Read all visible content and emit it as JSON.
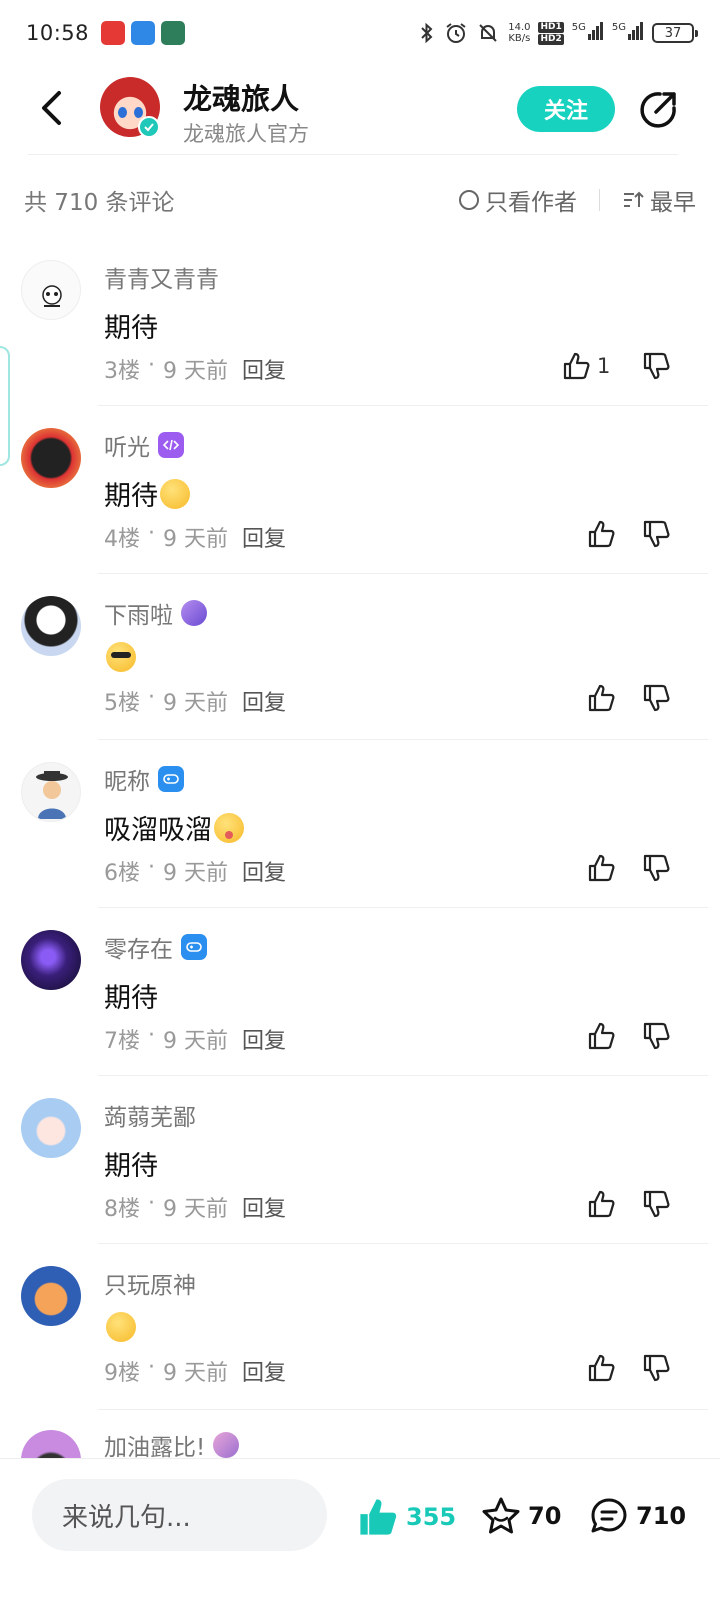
{
  "status_bar": {
    "time": "10:58",
    "speed_value": "14.0",
    "speed_unit": "KB/s",
    "hd1": "HD1",
    "hd2": "HD2",
    "net1": "5G",
    "net2": "5G",
    "battery": "37"
  },
  "header": {
    "author_name": "龙魂旅人",
    "author_subtitle": "龙魂旅人官方",
    "follow_label": "关注"
  },
  "comments_bar": {
    "count_text": "共 710 条评论",
    "only_author_label": "只看作者",
    "sort_label": "最早"
  },
  "comments": [
    {
      "name": "青青又青青",
      "text": "期待",
      "floor": "3楼",
      "time": "9 天前",
      "reply": "回复",
      "likes": "1"
    },
    {
      "name": "听光",
      "text": "期待",
      "floor": "4楼",
      "time": "9 天前",
      "reply": "回复",
      "likes": ""
    },
    {
      "name": "下雨啦",
      "text": "",
      "floor": "5楼",
      "time": "9 天前",
      "reply": "回复",
      "likes": ""
    },
    {
      "name": "昵称",
      "text": "吸溜吸溜",
      "floor": "6楼",
      "time": "9 天前",
      "reply": "回复",
      "likes": ""
    },
    {
      "name": "零存在",
      "text": "期待",
      "floor": "7楼",
      "time": "9 天前",
      "reply": "回复",
      "likes": ""
    },
    {
      "name": "蒟蒻芜鄙",
      "text": "期待",
      "floor": "8楼",
      "time": "9 天前",
      "reply": "回复",
      "likes": ""
    },
    {
      "name": "只玩原神",
      "text": "",
      "floor": "9楼",
      "time": "9 天前",
      "reply": "回复",
      "likes": ""
    },
    {
      "name": "加油露比!",
      "text": "",
      "floor": "",
      "time": "",
      "reply": "",
      "likes": ""
    }
  ],
  "bottom_bar": {
    "input_placeholder": "来说几句...",
    "like_count": "355",
    "star_count": "70",
    "comment_count": "710"
  },
  "colors": {
    "accent": "#18d2c0",
    "text_primary": "#111111",
    "text_secondary": "#777777"
  }
}
